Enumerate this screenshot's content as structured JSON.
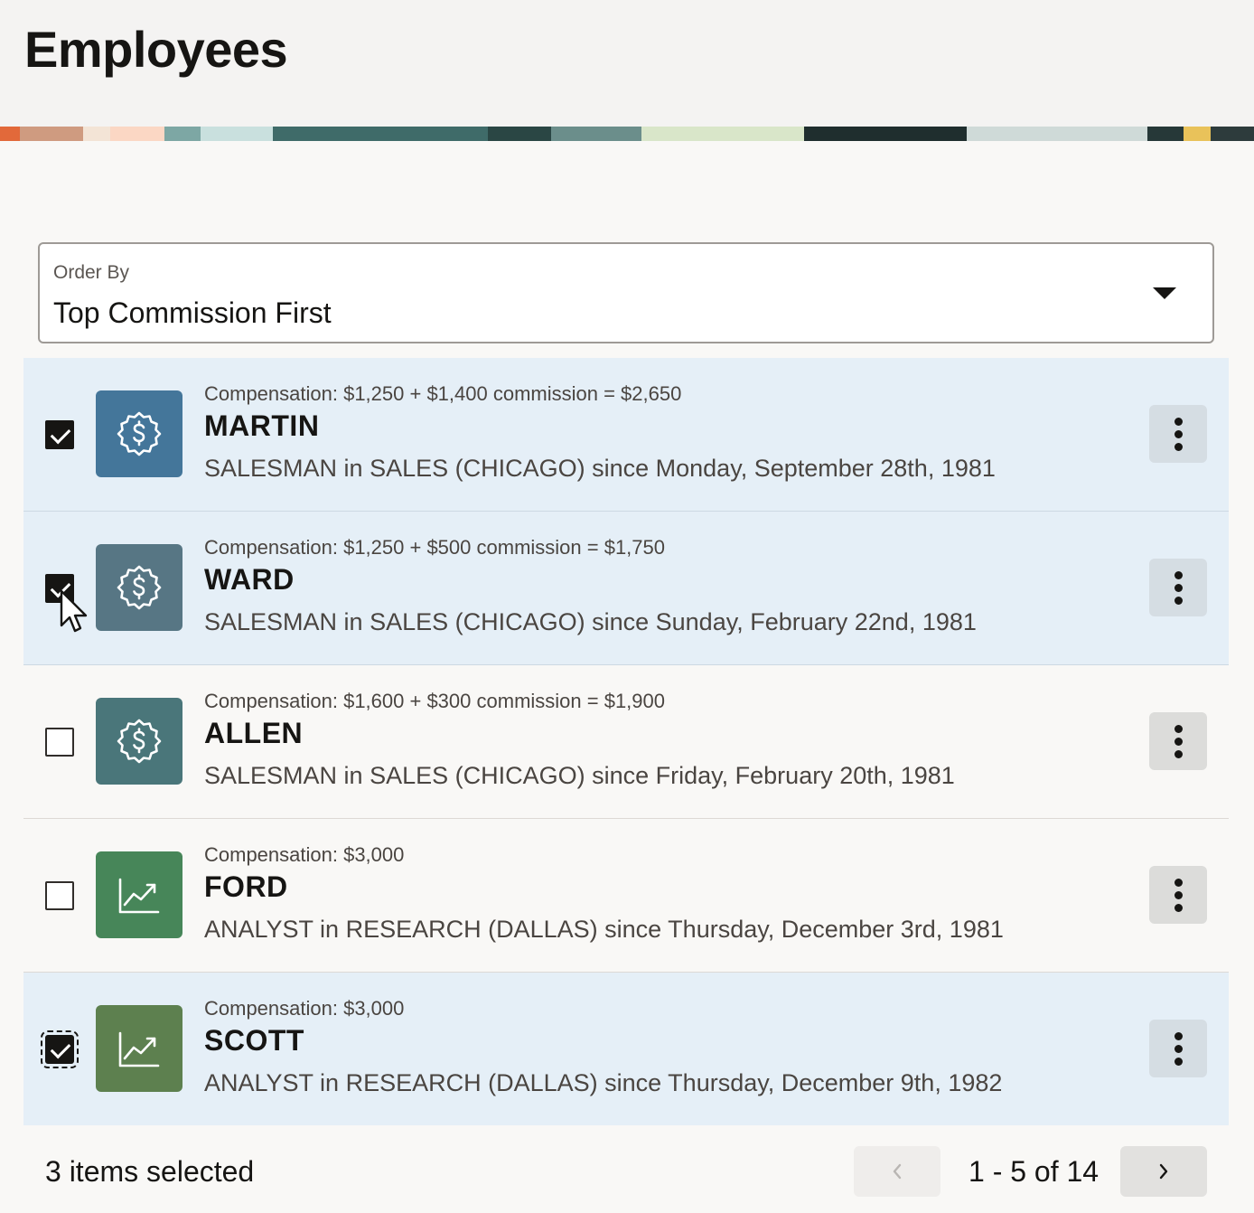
{
  "page": {
    "title": "Employees"
  },
  "order_by": {
    "label": "Order By",
    "value": "Top Commission First"
  },
  "colors": {
    "selected_row": "#e5eff7",
    "checkbox_checked": "#161513",
    "icon_commission_1": "#44769a",
    "icon_commission_2": "#577684",
    "icon_commission_3": "#4a767a",
    "icon_analyst_1": "#478659",
    "icon_analyst_2": "#5d804f"
  },
  "employees": [
    {
      "compensation": "Compensation: $1,250 + $1,400 commission = $2,650",
      "name": "MARTIN",
      "description": "SALESMAN in SALES (CHICAGO) since Monday, September 28th, 1981",
      "icon": "commission-icon",
      "selected": true
    },
    {
      "compensation": "Compensation: $1,250 + $500 commission = $1,750",
      "name": "WARD",
      "description": "SALESMAN in SALES (CHICAGO) since Sunday, February 22nd, 1981",
      "icon": "commission-icon",
      "selected": true
    },
    {
      "compensation": "Compensation: $1,600 + $300 commission = $1,900",
      "name": "ALLEN",
      "description": "SALESMAN in SALES (CHICAGO) since Friday, February 20th, 1981",
      "icon": "commission-icon",
      "selected": false
    },
    {
      "compensation": "Compensation: $3,000",
      "name": "FORD",
      "description": "ANALYST in RESEARCH (DALLAS) since Thursday, December 3rd, 1981",
      "icon": "trend-chart-icon",
      "selected": false
    },
    {
      "compensation": "Compensation: $3,000",
      "name": "SCOTT",
      "description": "ANALYST in RESEARCH (DALLAS) since Thursday, December 9th, 1982",
      "icon": "trend-chart-icon",
      "selected": true
    }
  ],
  "footer": {
    "selected_count": "3 items selected",
    "pagination": "1 - 5 of 14"
  }
}
